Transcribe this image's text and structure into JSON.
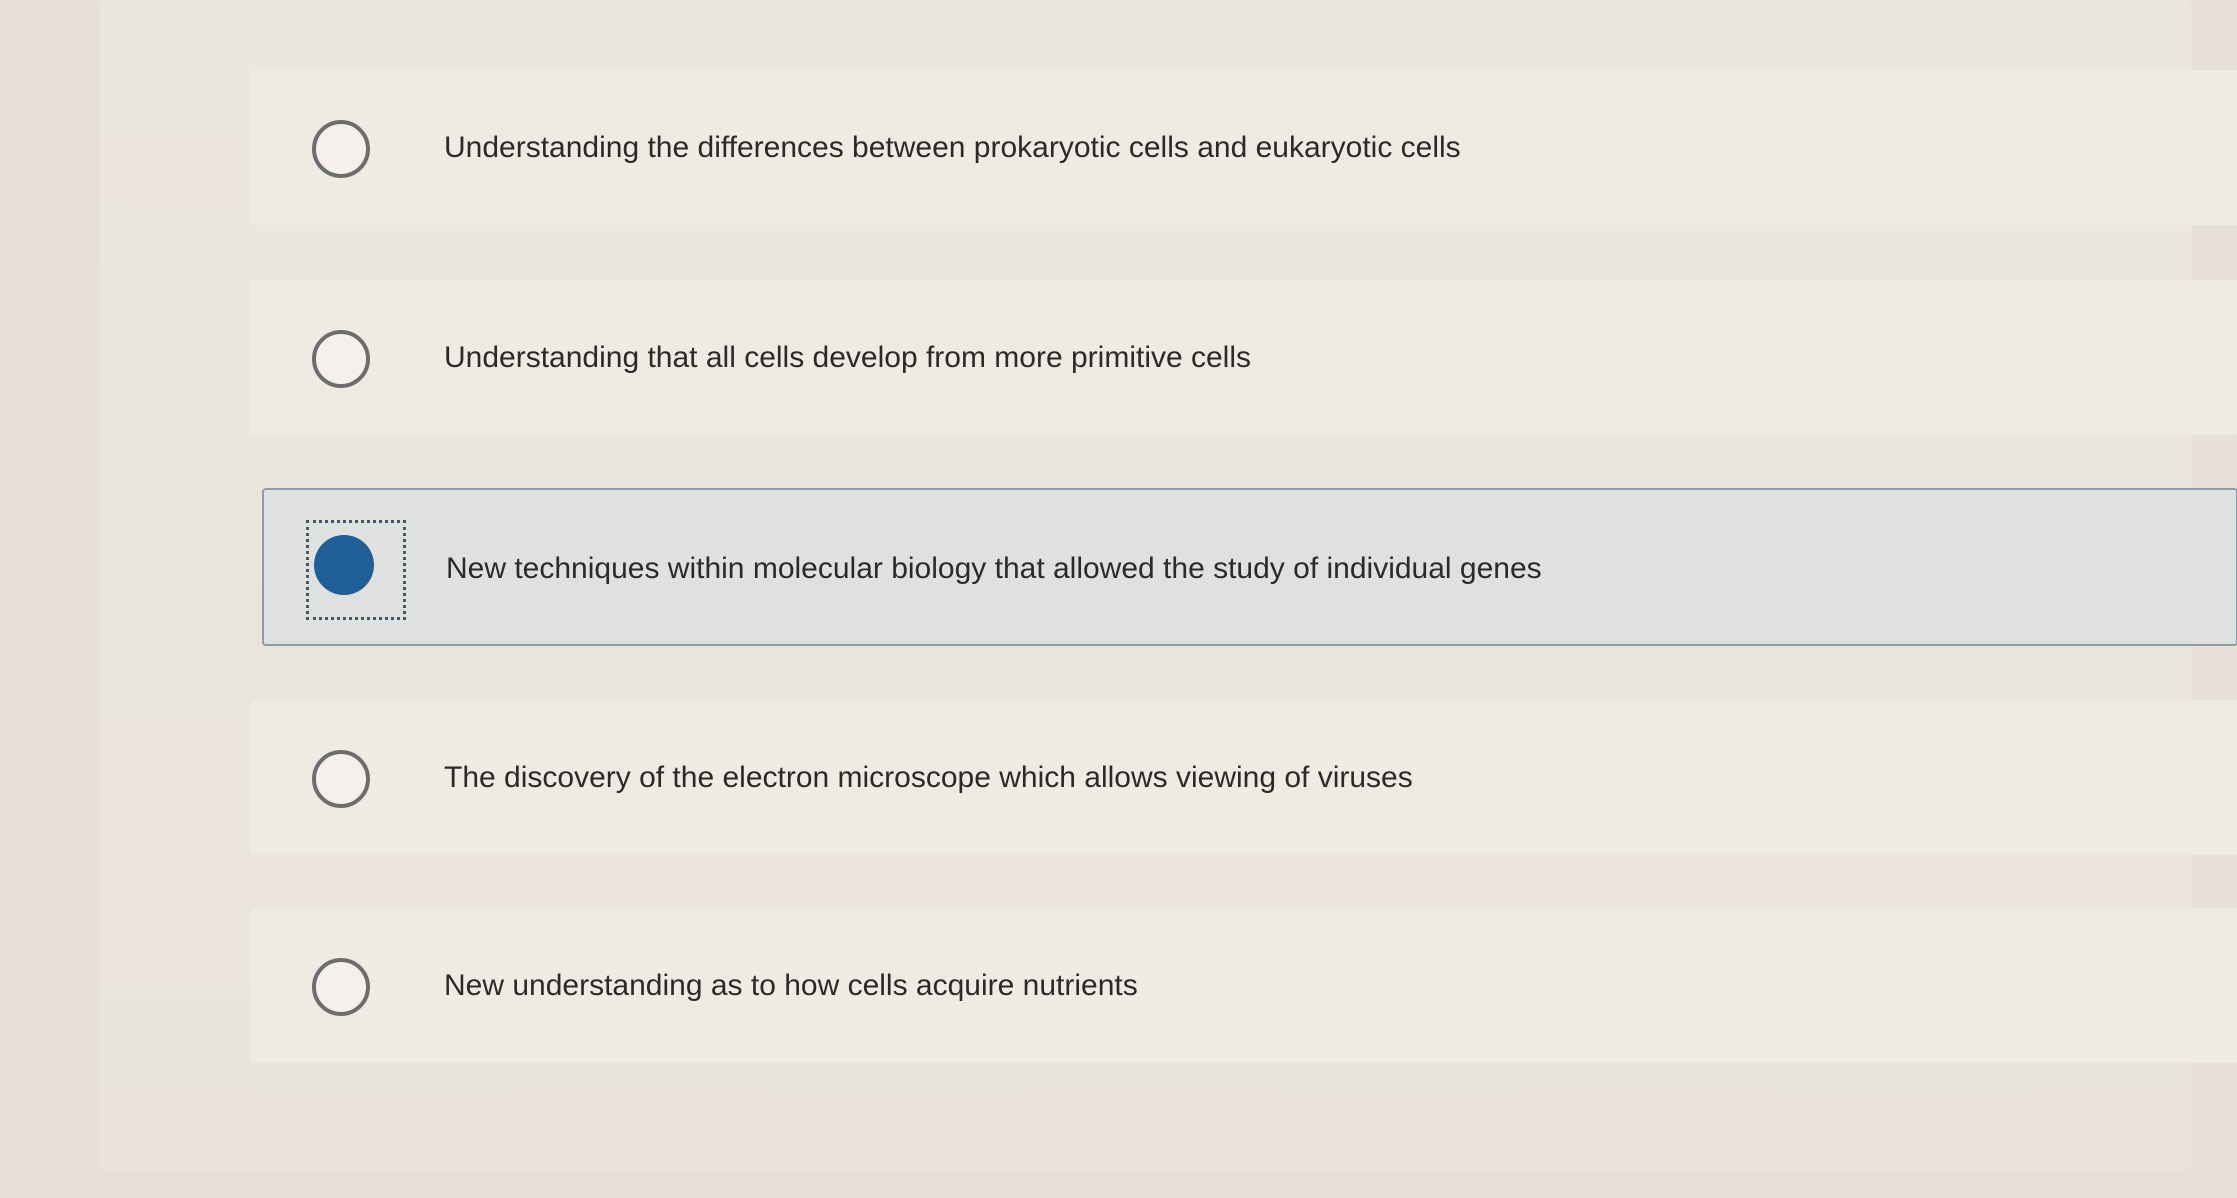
{
  "question": {
    "options": [
      {
        "label": "Understanding the differences between prokaryotic cells and eukaryotic cells",
        "selected": false
      },
      {
        "label": "Understanding that all cells develop from more primitive cells",
        "selected": false
      },
      {
        "label": "New techniques within molecular biology that allowed the study of individual genes",
        "selected": true
      },
      {
        "label": "The discovery of the electron microscope which allows viewing of viruses",
        "selected": false
      },
      {
        "label": "New understanding as to how cells acquire nutrients",
        "selected": false
      }
    ],
    "colors": {
      "selected_radio": "#1f5e96",
      "selected_background": "#dfe1e0",
      "selected_border": "#8e9aa6"
    }
  }
}
